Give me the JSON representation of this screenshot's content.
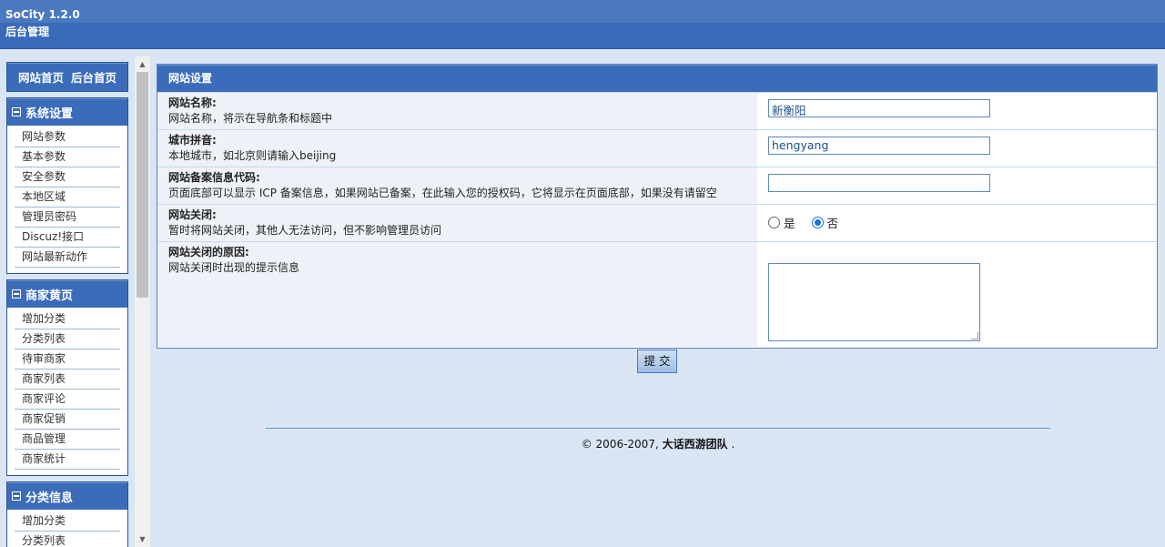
{
  "header": {
    "app_title": "SoCity 1.2.0",
    "sub_title": "后台管理"
  },
  "sidebar": {
    "top_links": [
      "网站首页",
      "后台首页"
    ],
    "groups": [
      {
        "title": "系统设置",
        "items": [
          "网站参数",
          "基本参数",
          "安全参数",
          "本地区域",
          "管理员密码",
          "Discuz!接口",
          "网站最新动作"
        ]
      },
      {
        "title": "商家黄页",
        "items": [
          "增加分类",
          "分类列表",
          "待审商家",
          "商家列表",
          "商家评论",
          "商家促销",
          "商品管理",
          "商家统计"
        ]
      },
      {
        "title": "分类信息",
        "items": [
          "增加分类",
          "分类列表"
        ]
      }
    ]
  },
  "panel": {
    "title": "网站设置",
    "fields": {
      "site_name": {
        "label": "网站名称:",
        "desc": "网站名称，将示在导航条和标题中",
        "value": "新衡阳"
      },
      "city_pinyin": {
        "label": "城市拼音:",
        "desc": "本地城市，如北京则请输入beijing",
        "value": "hengyang"
      },
      "icp": {
        "label": "网站备案信息代码:",
        "desc": "页面底部可以显示 ICP 备案信息，如果网站已备案，在此输入您的授权码，它将显示在页面底部，如果没有请留空",
        "value": ""
      },
      "site_close": {
        "label": "网站关闭:",
        "desc": "暂时将网站关闭，其他人无法访问，但不影响管理员访问",
        "options": [
          "是",
          "否"
        ],
        "selected": "否"
      },
      "close_reason": {
        "label": "网站关闭的原因:",
        "desc": "网站关闭时出现的提示信息",
        "value": ""
      }
    }
  },
  "submit_label": "提 交",
  "footer": {
    "copyright": "© 2006-2007,",
    "team": "大话西游团队",
    "end": "."
  },
  "colors": {
    "header": "#4a79c0",
    "panel_head": "#3b6cba",
    "background": "#d9e5f3",
    "label_bg": "#eef2f8"
  }
}
